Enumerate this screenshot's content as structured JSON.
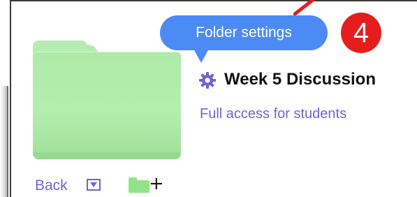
{
  "tooltip": {
    "text": "Folder settings",
    "color": "#4c8bf5"
  },
  "step_badge": {
    "number": "4",
    "color": "#e51d1d"
  },
  "folder": {
    "name": "Week 5 Discussion",
    "access": "Full access for students",
    "color": "#b4eeaf",
    "settings_icon": "gear-icon"
  },
  "navigation": {
    "back_label": "Back",
    "back_dropdown_icon": "dropdown-arrow-icon",
    "new_folder_icon": "folder-plus-icon"
  },
  "colors": {
    "link": "#6f63d6",
    "accent": "#4c8bf5",
    "annotation": "#e51d1d"
  }
}
